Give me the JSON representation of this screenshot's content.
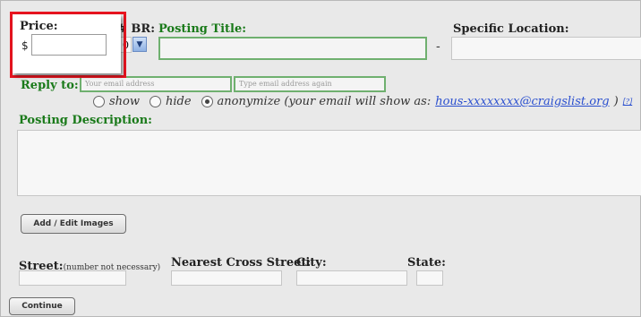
{
  "price_popup": {
    "label": "Price:",
    "currency": "$",
    "value": ""
  },
  "form": {
    "br_label": "# BR:",
    "br_value": "0",
    "posting_title_label": "Posting Title:",
    "dash": "-",
    "specific_location_label": "Specific Location:",
    "reply_to_label": "Reply to:",
    "email_placeholder": "Your email address",
    "email_again_placeholder": "Type email address again",
    "reply_options": {
      "show": "show",
      "hide": "hide",
      "anonymize": "anonymize (your email will show as:",
      "anon_email": "hous-xxxxxxxx@craigslist.org",
      "close_paren": ")",
      "help": "[?]",
      "selected": "anonymize"
    },
    "posting_description_label": "Posting Description:",
    "add_images_button": "Add / Edit Images",
    "street_label": "Street:",
    "street_note": "(number not necessary)",
    "nearest_cross_label": "Nearest Cross Street:",
    "city_label": "City:",
    "state_label": "State:",
    "continue_button": "Continue"
  },
  "colors": {
    "highlight": "#e8141f",
    "green": "#1a7a1a",
    "link": "#2a4fcf"
  }
}
